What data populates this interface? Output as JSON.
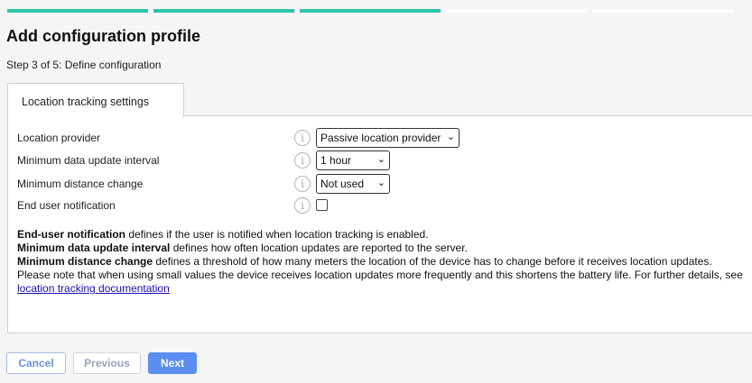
{
  "wizard": {
    "total_steps": 5,
    "completed_steps": 3,
    "title": "Add configuration profile",
    "step_text": "Step 3 of 5: Define configuration"
  },
  "tab": {
    "label": "Location tracking settings"
  },
  "settings": {
    "location_provider": {
      "label": "Location provider",
      "selected": "Passive location provider"
    },
    "min_update_interval": {
      "label": "Minimum data update interval",
      "selected": "1 hour"
    },
    "min_distance_change": {
      "label": "Minimum distance change",
      "selected": "Not used"
    },
    "end_user_notification": {
      "label": "End user notification",
      "checked": false
    }
  },
  "help": {
    "l1_bold": "End-user notification",
    "l1_rest": " defines if the user is notified when location tracking is enabled.",
    "l2_bold": "Minimum data update interval",
    "l2_rest": " defines how often location updates are reported to the server.",
    "l3_bold": "Minimum distance change",
    "l3_rest": " defines a threshold of how many meters the location of the device has to change before it receives location updates.",
    "l4": "Please note that when using small values the device receives location updates more frequently and this shortens the battery life. For further details, see",
    "link": "location tracking documentation"
  },
  "buttons": {
    "cancel": "Cancel",
    "previous": "Previous",
    "next": "Next"
  },
  "icons": {
    "info": "i",
    "chevron": "⌄"
  },
  "colors": {
    "progress_done": "#2ec4a9",
    "primary": "#5b8ef0",
    "link": "#1a0dab"
  }
}
